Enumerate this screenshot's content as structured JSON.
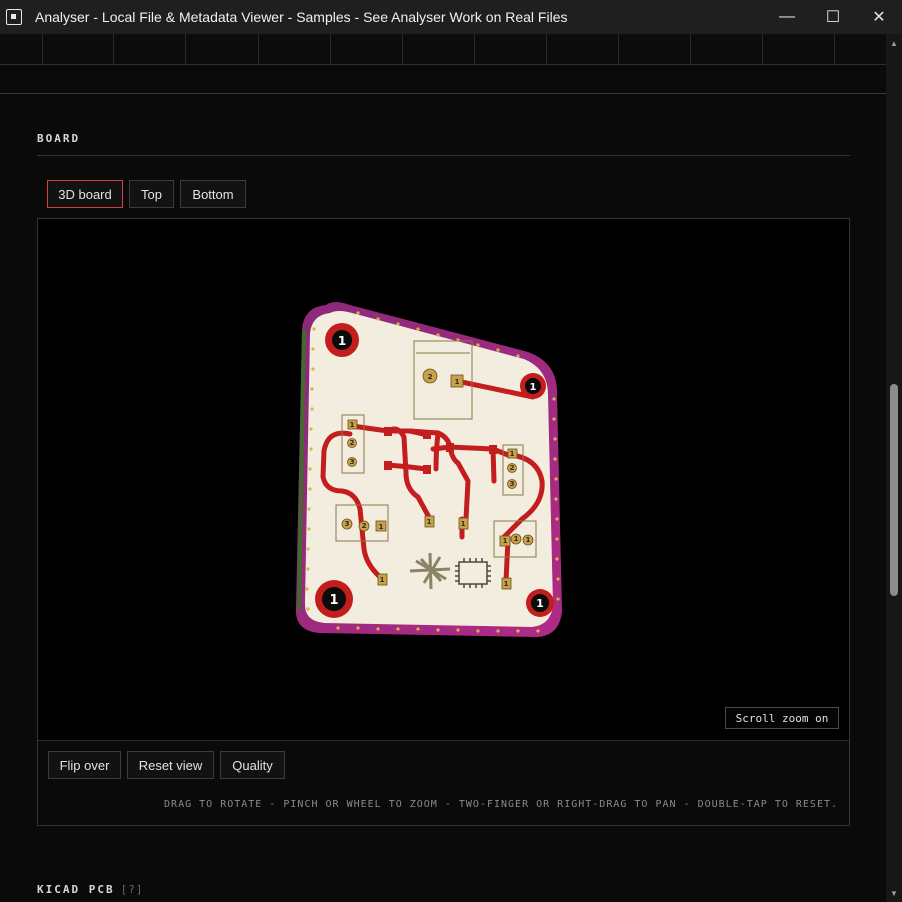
{
  "window": {
    "title": "Analyser - Local File & Metadata Viewer - Samples - See Analyser Work on Real Files",
    "minimize": "—",
    "maximize": "☐",
    "close": "✕"
  },
  "board": {
    "heading": "BOARD",
    "tabs": [
      {
        "label": "3D board",
        "active": true
      },
      {
        "label": "Top",
        "active": false
      },
      {
        "label": "Bottom",
        "active": false
      }
    ],
    "zoom_badge": "Scroll zoom on",
    "controls": [
      "Flip over",
      "Reset view",
      "Quality"
    ],
    "hint": "DRAG TO ROTATE - PINCH OR WHEEL TO ZOOM - TWO-FINGER OR RIGHT-DRAG TO PAN - DOUBLE-TAP TO RESET.",
    "pad_labels": [
      "1",
      "2",
      "3"
    ],
    "colors": {
      "board_fill": "#f3ede0",
      "board_edge": "#9b2a7c",
      "trace": "#c31d1d",
      "pad": "#c9a14a",
      "active_tab_border": "#d0413f"
    }
  },
  "next_section": {
    "heading": "KICAD PCB",
    "help": "[?]"
  }
}
